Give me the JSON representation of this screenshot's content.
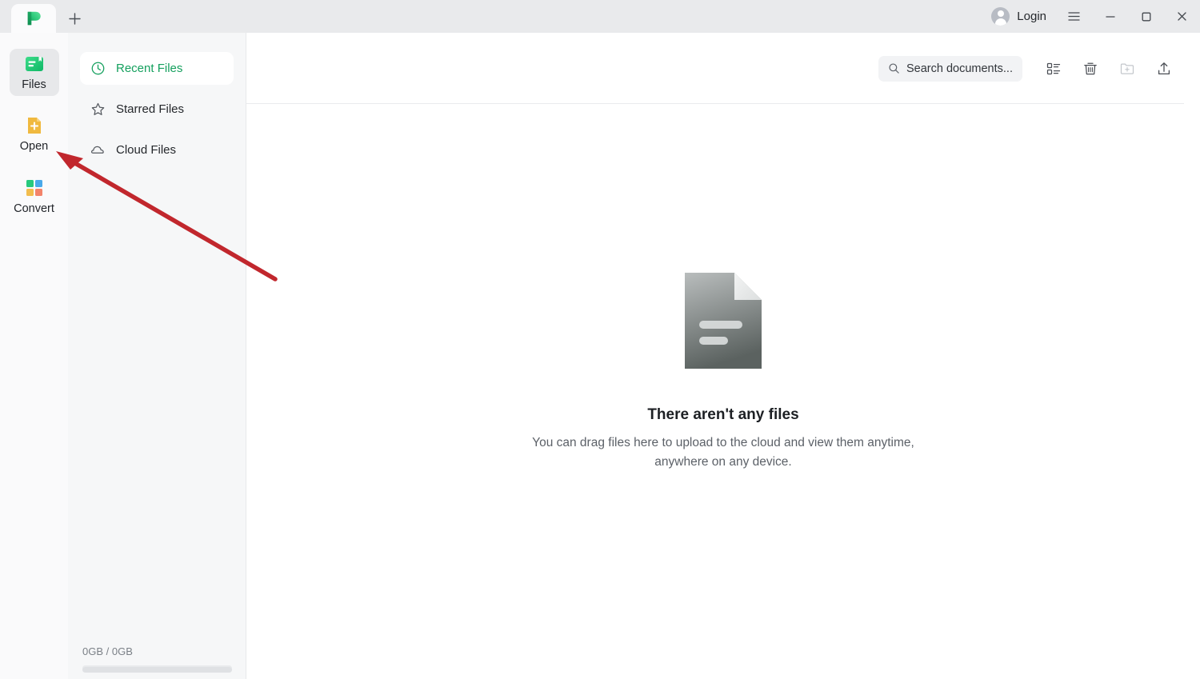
{
  "window": {
    "logo_icon": "app-logo-green-p",
    "new_tab_icon": "plus-icon",
    "login_label": "Login",
    "avatar_icon": "user-avatar-icon",
    "menu_icon": "hamburger-menu-icon",
    "minimize_icon": "minimize-icon",
    "maximize_icon": "maximize-icon",
    "close_icon": "close-icon"
  },
  "rail": {
    "items": [
      {
        "label": "Files",
        "icon": "files-document-icon",
        "selected": true
      },
      {
        "label": "Open",
        "icon": "open-file-plus-icon",
        "selected": false
      },
      {
        "label": "Convert",
        "icon": "convert-grid-icon",
        "selected": false
      }
    ]
  },
  "nav": {
    "items": [
      {
        "label": "Recent Files",
        "icon": "clock-icon",
        "active": true
      },
      {
        "label": "Starred Files",
        "icon": "star-icon",
        "active": false
      },
      {
        "label": "Cloud Files",
        "icon": "cloud-icon",
        "active": false
      }
    ]
  },
  "storage": {
    "text": "0GB / 0GB",
    "used_percent": 0
  },
  "toolbar": {
    "search_placeholder": "Search documents...",
    "search_value": "",
    "search_icon": "search-icon",
    "buttons": [
      {
        "name": "list-view-button",
        "icon": "list-view-icon",
        "muted": false
      },
      {
        "name": "trash-button",
        "icon": "trash-icon",
        "muted": false
      },
      {
        "name": "new-folder-button",
        "icon": "new-folder-icon",
        "muted": true
      },
      {
        "name": "upload-button",
        "icon": "upload-icon",
        "muted": false
      }
    ]
  },
  "empty_state": {
    "illustration_icon": "document-page-icon",
    "title": "There aren't any files",
    "subtitle": "You can drag files here to upload to the cloud and view them anytime, anywhere on any device."
  },
  "annotation": {
    "arrow_color": "#c1272d",
    "points_at": "open-rail-item"
  },
  "colors": {
    "brand_green": "#15a05e",
    "titlebar_bg": "#e9eaec",
    "sidebar_bg": "#f6f7f8",
    "rail_bg": "#fafafb",
    "content_bg": "#ffffff",
    "annotation_red": "#c1272d"
  }
}
